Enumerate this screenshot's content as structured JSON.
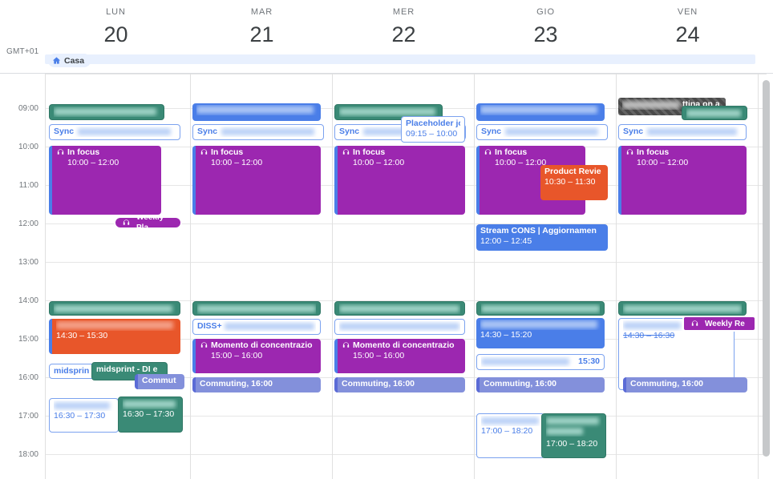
{
  "app": {
    "timezone_label": "GMT+01",
    "view": "week"
  },
  "header": {
    "days": [
      {
        "dow": "LUN",
        "num": "20"
      },
      {
        "dow": "MAR",
        "num": "21"
      },
      {
        "dow": "MER",
        "num": "22"
      },
      {
        "dow": "GIO",
        "num": "23"
      },
      {
        "dow": "VEN",
        "num": "24"
      }
    ]
  },
  "all_day": {
    "chip_label": "Casa",
    "chip_icon": "home-icon"
  },
  "time_axis": {
    "labels": [
      "09:00",
      "10:00",
      "11:00",
      "12:00",
      "13:00",
      "14:00",
      "15:00",
      "16:00",
      "17:00",
      "18:00"
    ]
  },
  "events": {
    "mon": {
      "green_morning": {
        "title": "",
        "redacted": true
      },
      "sync": {
        "title": "Sync",
        "rest_redacted": true
      },
      "in_focus": {
        "title": "In focus",
        "time": "10:00 – 12:00",
        "icon": "headphones-icon"
      },
      "weekly_chip": {
        "title": "Weekly Pla",
        "icon": "headphones-icon"
      },
      "green_afternoon": {
        "title": "",
        "redacted": true
      },
      "orange": {
        "title": "",
        "time": "14:30 – 15:30",
        "redacted": true
      },
      "midsprint_outline": {
        "title": "midsprin"
      },
      "midsprint_green": {
        "title": "midsprint - DI e"
      },
      "commuting_chip": {
        "title": "Commut"
      },
      "evening_outline": {
        "title": "",
        "time": "16:30 – 17:30",
        "redacted": true
      },
      "evening_green": {
        "title": "",
        "time": "16:30 – 17:30",
        "redacted": true
      }
    },
    "tue": {
      "blue_morning": {
        "title": "",
        "redacted": true
      },
      "sync": {
        "title": "Sync",
        "rest_redacted": true
      },
      "in_focus": {
        "title": "In focus",
        "time": "10:00 – 12:00",
        "icon": "headphones-icon"
      },
      "green_afternoon": {
        "title": "",
        "redacted": true
      },
      "diss": {
        "title": "DISS+",
        "rest_redacted": true
      },
      "momento": {
        "title": "Momento di concentrazio",
        "time": "15:00 – 16:00",
        "icon": "headphones-icon"
      },
      "commuting": {
        "title": "Commuting, 16:00"
      }
    },
    "wed": {
      "green_morning": {
        "title": "",
        "redacted": true
      },
      "sync": {
        "title": "Sync",
        "rest_redacted": true
      },
      "placeholder": {
        "title": "Placeholder jo",
        "time": "09:15 – 10:00"
      },
      "in_focus": {
        "title": "In focus",
        "time": "10:00 – 12:00",
        "icon": "headphones-icon"
      },
      "green_afternoon": {
        "title": "",
        "redacted": true
      },
      "outline_afternoon": {
        "title": "",
        "redacted": true
      },
      "momento": {
        "title": "Momento di concentrazio",
        "time": "15:00 – 16:00",
        "icon": "headphones-icon"
      },
      "commuting": {
        "title": "Commuting, 16:00"
      }
    },
    "thu": {
      "blue_morning": {
        "title": "",
        "redacted": true
      },
      "sync": {
        "title": "Sync",
        "rest_redacted": true
      },
      "in_focus": {
        "title": "In focus",
        "time": "10:00 – 12:00",
        "icon": "headphones-icon"
      },
      "product_review": {
        "title": "Product Revie",
        "time": "10:30 – 11:30"
      },
      "stream_cons": {
        "title": "Stream CONS | Aggiornamen",
        "time": "12:00 – 12:45"
      },
      "green_afternoon": {
        "title": "",
        "redacted": true
      },
      "blue_afternoon": {
        "title": "",
        "time": "14:30 – 15:20",
        "redacted": true
      },
      "outline_1530": {
        "title": "",
        "time": "15:30",
        "redacted": true
      },
      "commuting": {
        "title": "Commuting, 16:00"
      },
      "evening_outline": {
        "title": "",
        "time": "17:00 – 18:20",
        "redacted": true
      },
      "evening_green": {
        "title": "",
        "time": "17:00 – 18:20",
        "redacted": true
      }
    },
    "fri": {
      "dark_morning": {
        "title": "",
        "title_suffix": "ttina on a",
        "redacted": true
      },
      "green_morning": {
        "title": "",
        "redacted": true
      },
      "sync": {
        "title": "Sync",
        "rest_redacted": true
      },
      "in_focus": {
        "title": "In focus",
        "time": "10:00 – 12:00",
        "icon": "headphones-icon"
      },
      "green_afternoon": {
        "title": "",
        "redacted": true
      },
      "declined": {
        "title": "",
        "time": "14:30 – 16:30",
        "redacted": true,
        "declined": true
      },
      "weekly_chip": {
        "title": "Weekly Re",
        "icon": "headphones-icon"
      },
      "commuting": {
        "title": "Commuting, 16:00"
      }
    }
  },
  "colors": {
    "green": "#3a8a76",
    "blue": "#4a7ee8",
    "purple": "#9c27b0",
    "orange": "#e8562a",
    "periwinkle": "#8390db",
    "dark": "#4a4a4a",
    "allday_band": "#e8f0fe",
    "grid_line": "#e6e6e6",
    "text_muted": "#70757a"
  }
}
